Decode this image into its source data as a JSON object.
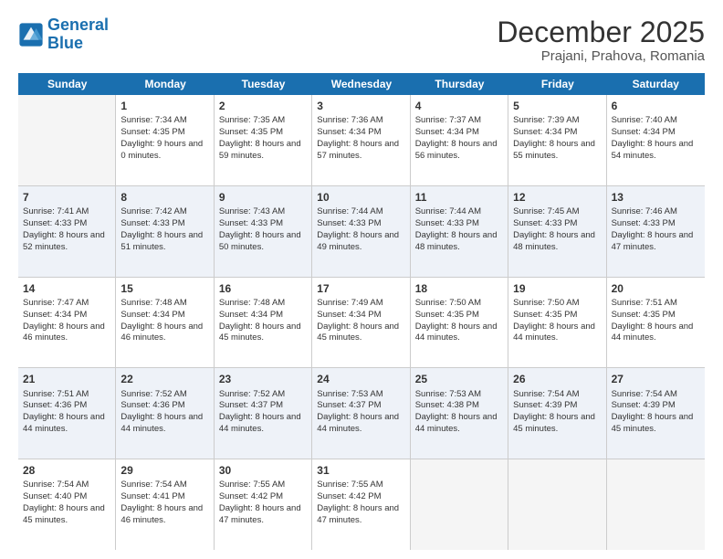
{
  "header": {
    "logo_line1": "General",
    "logo_line2": "Blue",
    "title": "December 2025",
    "subtitle": "Prajani, Prahova, Romania"
  },
  "days": [
    "Sunday",
    "Monday",
    "Tuesday",
    "Wednesday",
    "Thursday",
    "Friday",
    "Saturday"
  ],
  "weeks": [
    [
      {
        "num": "",
        "sunrise": "",
        "sunset": "",
        "daylight": "",
        "empty": true
      },
      {
        "num": "1",
        "sunrise": "Sunrise: 7:34 AM",
        "sunset": "Sunset: 4:35 PM",
        "daylight": "Daylight: 9 hours and 0 minutes."
      },
      {
        "num": "2",
        "sunrise": "Sunrise: 7:35 AM",
        "sunset": "Sunset: 4:35 PM",
        "daylight": "Daylight: 8 hours and 59 minutes."
      },
      {
        "num": "3",
        "sunrise": "Sunrise: 7:36 AM",
        "sunset": "Sunset: 4:34 PM",
        "daylight": "Daylight: 8 hours and 57 minutes."
      },
      {
        "num": "4",
        "sunrise": "Sunrise: 7:37 AM",
        "sunset": "Sunset: 4:34 PM",
        "daylight": "Daylight: 8 hours and 56 minutes."
      },
      {
        "num": "5",
        "sunrise": "Sunrise: 7:39 AM",
        "sunset": "Sunset: 4:34 PM",
        "daylight": "Daylight: 8 hours and 55 minutes."
      },
      {
        "num": "6",
        "sunrise": "Sunrise: 7:40 AM",
        "sunset": "Sunset: 4:34 PM",
        "daylight": "Daylight: 8 hours and 54 minutes."
      }
    ],
    [
      {
        "num": "7",
        "sunrise": "Sunrise: 7:41 AM",
        "sunset": "Sunset: 4:33 PM",
        "daylight": "Daylight: 8 hours and 52 minutes."
      },
      {
        "num": "8",
        "sunrise": "Sunrise: 7:42 AM",
        "sunset": "Sunset: 4:33 PM",
        "daylight": "Daylight: 8 hours and 51 minutes."
      },
      {
        "num": "9",
        "sunrise": "Sunrise: 7:43 AM",
        "sunset": "Sunset: 4:33 PM",
        "daylight": "Daylight: 8 hours and 50 minutes."
      },
      {
        "num": "10",
        "sunrise": "Sunrise: 7:44 AM",
        "sunset": "Sunset: 4:33 PM",
        "daylight": "Daylight: 8 hours and 49 minutes."
      },
      {
        "num": "11",
        "sunrise": "Sunrise: 7:44 AM",
        "sunset": "Sunset: 4:33 PM",
        "daylight": "Daylight: 8 hours and 48 minutes."
      },
      {
        "num": "12",
        "sunrise": "Sunrise: 7:45 AM",
        "sunset": "Sunset: 4:33 PM",
        "daylight": "Daylight: 8 hours and 48 minutes."
      },
      {
        "num": "13",
        "sunrise": "Sunrise: 7:46 AM",
        "sunset": "Sunset: 4:33 PM",
        "daylight": "Daylight: 8 hours and 47 minutes."
      }
    ],
    [
      {
        "num": "14",
        "sunrise": "Sunrise: 7:47 AM",
        "sunset": "Sunset: 4:34 PM",
        "daylight": "Daylight: 8 hours and 46 minutes."
      },
      {
        "num": "15",
        "sunrise": "Sunrise: 7:48 AM",
        "sunset": "Sunset: 4:34 PM",
        "daylight": "Daylight: 8 hours and 46 minutes."
      },
      {
        "num": "16",
        "sunrise": "Sunrise: 7:48 AM",
        "sunset": "Sunset: 4:34 PM",
        "daylight": "Daylight: 8 hours and 45 minutes."
      },
      {
        "num": "17",
        "sunrise": "Sunrise: 7:49 AM",
        "sunset": "Sunset: 4:34 PM",
        "daylight": "Daylight: 8 hours and 45 minutes."
      },
      {
        "num": "18",
        "sunrise": "Sunrise: 7:50 AM",
        "sunset": "Sunset: 4:35 PM",
        "daylight": "Daylight: 8 hours and 44 minutes."
      },
      {
        "num": "19",
        "sunrise": "Sunrise: 7:50 AM",
        "sunset": "Sunset: 4:35 PM",
        "daylight": "Daylight: 8 hours and 44 minutes."
      },
      {
        "num": "20",
        "sunrise": "Sunrise: 7:51 AM",
        "sunset": "Sunset: 4:35 PM",
        "daylight": "Daylight: 8 hours and 44 minutes."
      }
    ],
    [
      {
        "num": "21",
        "sunrise": "Sunrise: 7:51 AM",
        "sunset": "Sunset: 4:36 PM",
        "daylight": "Daylight: 8 hours and 44 minutes."
      },
      {
        "num": "22",
        "sunrise": "Sunrise: 7:52 AM",
        "sunset": "Sunset: 4:36 PM",
        "daylight": "Daylight: 8 hours and 44 minutes."
      },
      {
        "num": "23",
        "sunrise": "Sunrise: 7:52 AM",
        "sunset": "Sunset: 4:37 PM",
        "daylight": "Daylight: 8 hours and 44 minutes."
      },
      {
        "num": "24",
        "sunrise": "Sunrise: 7:53 AM",
        "sunset": "Sunset: 4:37 PM",
        "daylight": "Daylight: 8 hours and 44 minutes."
      },
      {
        "num": "25",
        "sunrise": "Sunrise: 7:53 AM",
        "sunset": "Sunset: 4:38 PM",
        "daylight": "Daylight: 8 hours and 44 minutes."
      },
      {
        "num": "26",
        "sunrise": "Sunrise: 7:54 AM",
        "sunset": "Sunset: 4:39 PM",
        "daylight": "Daylight: 8 hours and 45 minutes."
      },
      {
        "num": "27",
        "sunrise": "Sunrise: 7:54 AM",
        "sunset": "Sunset: 4:39 PM",
        "daylight": "Daylight: 8 hours and 45 minutes."
      }
    ],
    [
      {
        "num": "28",
        "sunrise": "Sunrise: 7:54 AM",
        "sunset": "Sunset: 4:40 PM",
        "daylight": "Daylight: 8 hours and 45 minutes."
      },
      {
        "num": "29",
        "sunrise": "Sunrise: 7:54 AM",
        "sunset": "Sunset: 4:41 PM",
        "daylight": "Daylight: 8 hours and 46 minutes."
      },
      {
        "num": "30",
        "sunrise": "Sunrise: 7:55 AM",
        "sunset": "Sunset: 4:42 PM",
        "daylight": "Daylight: 8 hours and 47 minutes."
      },
      {
        "num": "31",
        "sunrise": "Sunrise: 7:55 AM",
        "sunset": "Sunset: 4:42 PM",
        "daylight": "Daylight: 8 hours and 47 minutes."
      },
      {
        "num": "",
        "sunrise": "",
        "sunset": "",
        "daylight": "",
        "empty": true
      },
      {
        "num": "",
        "sunrise": "",
        "sunset": "",
        "daylight": "",
        "empty": true
      },
      {
        "num": "",
        "sunrise": "",
        "sunset": "",
        "daylight": "",
        "empty": true
      }
    ]
  ]
}
